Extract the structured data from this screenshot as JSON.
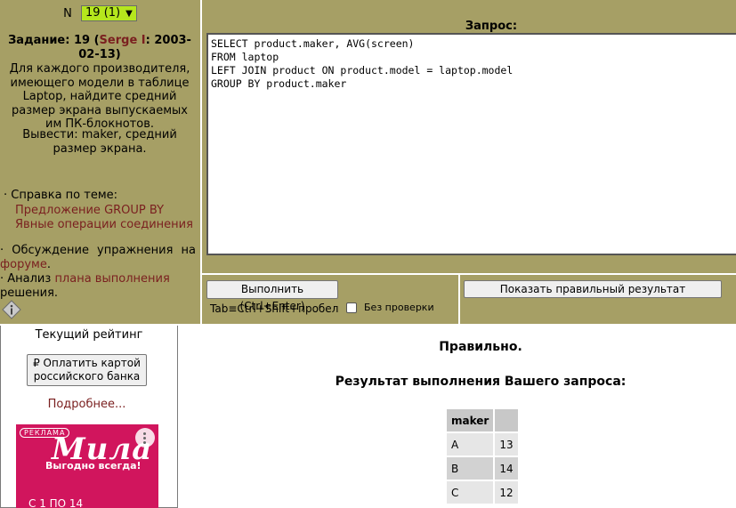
{
  "task": {
    "n_label": "N",
    "n_selected": "19 (1)",
    "title_prefix": "Задание: 19 (",
    "author": "Serge I",
    "title_suffix": ": 2003-02-13)",
    "body": "Для каждого производителя, имеющего модели в таблице Laptop, найдите средний размер экрана выпускаемых им ПК-блокнотов.",
    "output": "Вывести: maker, средний размер экрана."
  },
  "help": {
    "title": "· Справка по теме:",
    "links": [
      "Предложение GROUP BY",
      "Явные операции соединения"
    ]
  },
  "forum": {
    "prefix": "· Обсуждение упражнения на ",
    "link": "форуме",
    "suffix": "."
  },
  "plan": {
    "prefix": "· Анализ ",
    "link": "плана выполнения",
    "suffix": " решения."
  },
  "query": {
    "title": "Запрос:",
    "text": "SELECT product.maker, AVG(screen)\nFROM laptop\nLEFT JOIN product ON product.model = laptop.model\nGROUP BY product.maker"
  },
  "controls": {
    "execute_label": "Выполнить (Ctrl+Enter)",
    "tab_hint": "Tab≡Ctrl+Shift+пробел",
    "no_check_label": "Без проверки",
    "show_correct_label": "Показать правильный результат"
  },
  "sidebar": {
    "rating_title": "Текущий рейтинг",
    "pay_button": "₽ Оплатить картой российского банка",
    "more_link": "Подробнее..."
  },
  "ad": {
    "label": "РЕКЛАМА",
    "brand": "Мила",
    "slogan": "Выгодно всегда!",
    "date": "С 1 ПО 14"
  },
  "result": {
    "status": "Правильно.",
    "title": "Результат выполнения Вашего запроса:",
    "columns": [
      "maker",
      ""
    ],
    "rows": [
      [
        "A",
        "13"
      ],
      [
        "B",
        "14"
      ],
      [
        "C",
        "12"
      ]
    ]
  },
  "colors": {
    "panel_olive": "#a69f65",
    "link_red": "#7a1f1f",
    "select_green": "#b5e61d",
    "ad_pink": "#d1155d"
  }
}
